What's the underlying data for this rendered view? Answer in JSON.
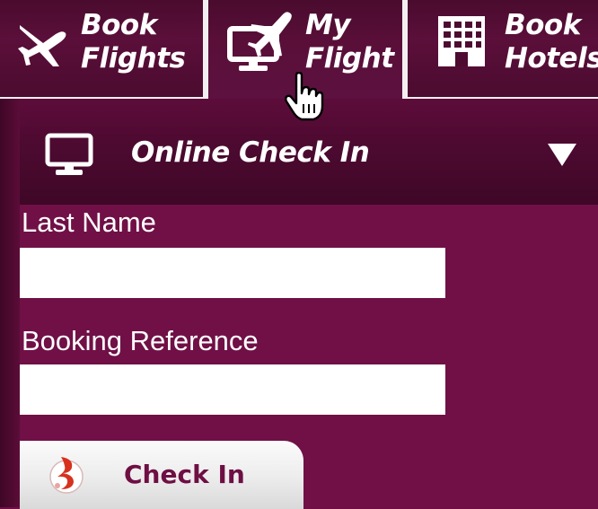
{
  "nav": {
    "tabs": [
      {
        "label": "Book\nFlights",
        "icon": "airplane-icon"
      },
      {
        "label": "My\nFlight",
        "icon": "monitor-airplane-icon"
      },
      {
        "label": "Book\nHotels",
        "icon": "hotel-building-icon"
      }
    ],
    "active_tab": "My Flight"
  },
  "panel": {
    "title": "Online Check In",
    "icon": "monitor-icon",
    "dropdown_icon": "triangle-down-icon",
    "fields": {
      "last_name": {
        "label": "Last Name",
        "value": "",
        "placeholder": ""
      },
      "booking_reference": {
        "label": "Booking Reference",
        "value": "",
        "placeholder": ""
      }
    },
    "checkin_button": {
      "label": "Check In",
      "icon": "airline-logo-icon"
    }
  },
  "colors": {
    "brand": "#6f0f45",
    "header_dark": "#4a0b2e",
    "button_text": "#6e0f43",
    "divider": "#f3eff1"
  }
}
